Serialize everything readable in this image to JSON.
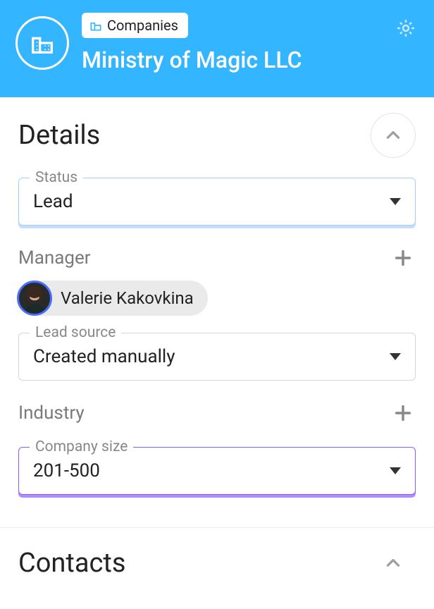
{
  "header": {
    "breadcrumb_label": "Companies",
    "title": "Ministry of Magic LLC"
  },
  "details": {
    "section_title": "Details",
    "status": {
      "label": "Status",
      "value": "Lead"
    },
    "manager": {
      "label": "Manager",
      "person_name": "Valerie Kakovkina"
    },
    "lead_source": {
      "label": "Lead source",
      "value": "Created manually"
    },
    "industry": {
      "label": "Industry"
    },
    "company_size": {
      "label": "Company size",
      "value": "201-500"
    }
  },
  "contacts": {
    "section_title": "Contacts"
  }
}
